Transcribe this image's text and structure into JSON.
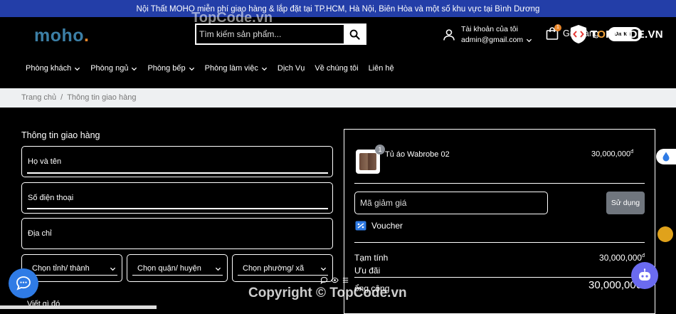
{
  "topbar": {
    "announcement": "Nội Thất MOHO miễn phí giao hàng & lắp đặt tại TP.HCM, Hà Nội, Biên Hòa và một số khu vực tại Bình Dương"
  },
  "header": {
    "logo": {
      "text": "moho",
      "dot": "."
    },
    "search": {
      "placeholder": "Tìm kiếm sản phẩm...",
      "value": "",
      "icon": "search-icon"
    },
    "account": {
      "label": "Tài khoản của tôi",
      "email": "admin@gmail.com",
      "icon": "user-icon"
    },
    "cart": {
      "label": "Giỏ hàng",
      "count": "1",
      "icon": "shopping-bag-icon"
    },
    "theme_toggle": {
      "label": "Dark"
    },
    "topcode_badge": {
      "prefix": "T",
      "highlight": "O",
      "suffix": "PCODE.VN"
    }
  },
  "nav": {
    "items": [
      {
        "label": "Phòng khách",
        "has_dropdown": true
      },
      {
        "label": "Phòng ngủ",
        "has_dropdown": true
      },
      {
        "label": "Phòng bếp",
        "has_dropdown": true
      },
      {
        "label": "Phòng làm việc",
        "has_dropdown": true
      },
      {
        "label": "Dịch Vụ",
        "has_dropdown": false
      },
      {
        "label": "Về chúng tôi",
        "has_dropdown": false
      },
      {
        "label": "Liên hệ",
        "has_dropdown": false
      }
    ]
  },
  "breadcrumb": {
    "home": "Trang chủ",
    "separator": "/",
    "current": "Thông tin giao hàng"
  },
  "shipping_form": {
    "title": "Thông tin giao hàng",
    "fields": {
      "name": "Họ và tên",
      "phone": "Số điện thoại",
      "address": "Địa chỉ",
      "note": "Viết gì đó"
    },
    "selects": {
      "province": "Chọn tỉnh/ thành",
      "district": "Chọn quận/ huyện",
      "ward": "Chọn phường/ xã"
    }
  },
  "order_summary": {
    "product": {
      "name": "Tủ áo Wabrobe 02",
      "price": "30,000,000",
      "currency": "đ",
      "quantity": "1"
    },
    "coupon": {
      "placeholder": "Mã giảm giá",
      "apply_label": "Sử dụng"
    },
    "voucher": {
      "label": "Voucher",
      "icon": "voucher-icon"
    },
    "subtotal": {
      "label": "Tạm tính",
      "value": "30,000,000",
      "currency": "đ"
    },
    "discount": {
      "label": "Ưu đãi",
      "value": "-"
    },
    "total": {
      "label": "ổng cộng",
      "value": "30,000,000",
      "currency": "đ"
    }
  },
  "overlays": {
    "watermark": "TopCode.vn",
    "copyright": "Copyright © TopCode.vn"
  },
  "colors": {
    "topbar": "#233ea8",
    "logo": "#3c7fa6",
    "accent": "#e8862a",
    "chat": "#2f7be5",
    "apply_button": "#70767e"
  }
}
